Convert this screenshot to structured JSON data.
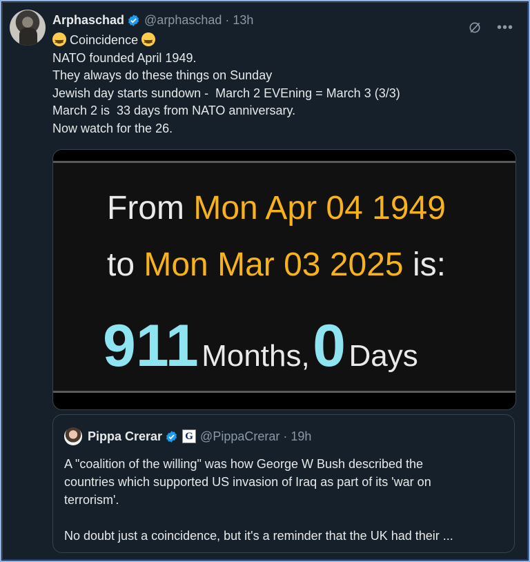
{
  "tweet": {
    "author_name": "Arphaschad",
    "handle": "@arphaschad",
    "separator": "·",
    "time": "13h",
    "lines": [
      "Coincidence",
      "NATO founded April 1949.",
      "They always do these things on Sunday",
      "Jewish day starts sundown -  March 2 EVEning = March 3 (3/3)",
      "March 2 is  33 days from NATO anniversary.",
      "Now watch for the 26."
    ],
    "emoji": "grinning-squinting-face"
  },
  "media": {
    "from_word": "From",
    "from_date": "Mon Apr 04 1949",
    "to_word": "to",
    "to_date": "Mon Mar 03 2025",
    "is_word": "is:",
    "months_value": "911",
    "months_label": "Months,",
    "days_value": "0",
    "days_label": "Days"
  },
  "quote": {
    "author_name": "Pippa Crerar",
    "affiliation_badge": "G",
    "handle": "@PippaCrerar",
    "separator": "·",
    "time": "19h",
    "lines": [
      "A \"coalition of the willing\" was how George W Bush described the",
      "countries which supported US invasion of Iraq as part of its 'war on",
      "terrorism'.",
      "",
      "No doubt just a coincidence, but it's a reminder that the UK had their ..."
    ]
  },
  "colors": {
    "background": "#15202b",
    "verified": "#1d9bf0",
    "accent_orange": "#f8b21a",
    "accent_cyan": "#8ee4f0"
  }
}
